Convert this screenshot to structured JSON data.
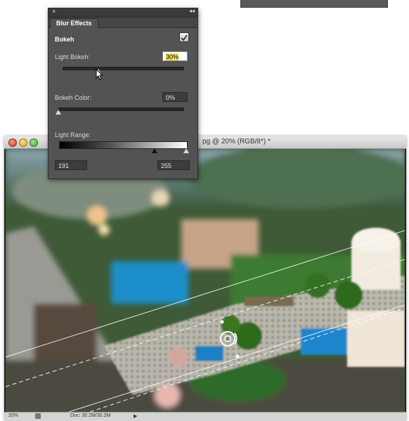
{
  "document_window": {
    "title": "pg @ 20% (RGB/8*) *",
    "status_bar": {
      "zoom": "20%",
      "doc_info": "Doc: 30.2M/30.2M",
      "arrow": "▶"
    }
  },
  "blur_panel": {
    "close_glyph": "×",
    "collapse_glyph": "◂◂",
    "tab_label": "Blur Effects",
    "section_title": "Bokeh",
    "bokeh_enabled": true,
    "light_bokeh": {
      "label": "Light Bokeh:",
      "value": "30%",
      "fraction": 0.3
    },
    "bokeh_color": {
      "label": "Bokeh Color:",
      "value": "0%",
      "fraction": 0.0
    },
    "light_range": {
      "label": "Light Range:",
      "low_value": "191",
      "high_value": "255",
      "low_fraction": 0.749,
      "high_fraction": 1.0
    }
  },
  "colors": {
    "panel_bg": "#535353",
    "field_highlight": "#f6e35a"
  },
  "icons": {
    "checkbox": "check-icon",
    "cursor": "pointer-cursor-icon"
  }
}
